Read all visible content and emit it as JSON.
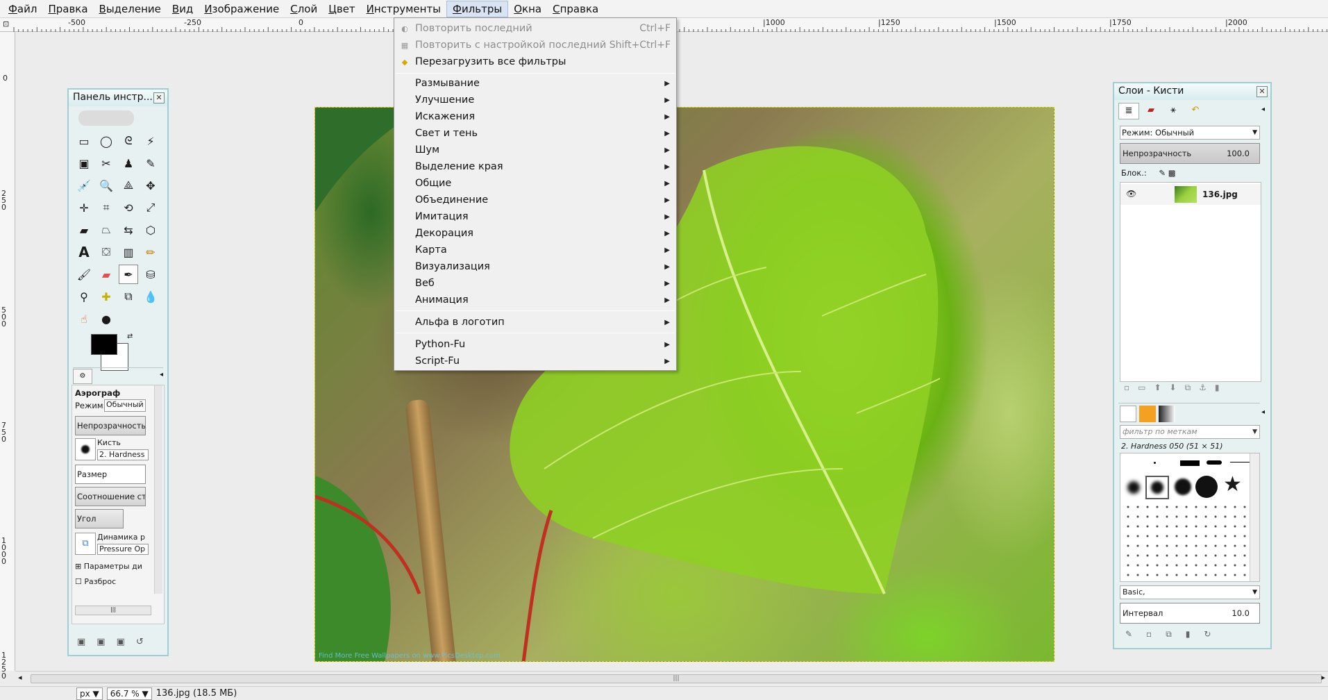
{
  "menubar": {
    "items": [
      "Файл",
      "Правка",
      "Выделение",
      "Вид",
      "Изображение",
      "Слой",
      "Цвет",
      "Инструменты",
      "Фильтры",
      "Окна",
      "Справка"
    ],
    "active": "Фильтры"
  },
  "ruler": {
    "h_labels": [
      "-500",
      "-250",
      "0",
      "|1000",
      "|1250",
      "|1500",
      "|1750",
      "|2000"
    ],
    "v_labels": [
      "0",
      "250",
      "500",
      "750",
      "1000",
      "1250"
    ]
  },
  "filters_menu": {
    "repeat_last": {
      "label": "Повторить последний",
      "shortcut": "Ctrl+F"
    },
    "reshow_last": {
      "label": "Повторить с настройкой последний",
      "shortcut": "Shift+Ctrl+F"
    },
    "reset_all": {
      "label": "Перезагрузить все фильтры"
    },
    "groups": [
      "Размывание",
      "Улучшение",
      "Искажения",
      "Свет и тень",
      "Шум",
      "Выделение края",
      "Общие",
      "Объединение",
      "Имитация",
      "Декорация",
      "Карта",
      "Визуализация",
      "Веб",
      "Анимация"
    ],
    "alpha_logo": "Альфа в логотип",
    "scripts": [
      "Python-Fu",
      "Script-Fu"
    ]
  },
  "toolbox": {
    "title": "Панель инстр...",
    "tool_name": "Аэрограф",
    "mode_label": "Режим:",
    "mode_value": "Обычный",
    "opacity_label": "Непрозрачность",
    "brush_label": "Кисть",
    "brush_value": "2. Hardness",
    "size_label": "Размер",
    "aspect_label": "Соотношение ст.",
    "angle_label": "Угол",
    "dynamics_label": "Динамика р",
    "dynamics_value": "Pressure Op",
    "dynamics_params": "Параметры ди",
    "scatter_label": "Разброс"
  },
  "layers": {
    "title": "Слои - Кисти",
    "mode_label": "Режим: Обычный",
    "opacity_label": "Непрозрачность",
    "opacity_value": "100.0",
    "lock_label": "Блок.:",
    "layer_name": "136.jpg",
    "brush_filter_placeholder": "фильтр по меткам",
    "brush_selected": "2. Hardness 050 (51 × 51)",
    "brush_preset": "Basic,",
    "spacing_label": "Интервал",
    "spacing_value": "10.0"
  },
  "image": {
    "watermark": "Find More Free Wallpapers on www.PicsDesktop.com"
  },
  "statusbar": {
    "unit": "px",
    "zoom": "66.7 %",
    "file_info": "136.jpg (18.5 МБ)"
  },
  "colors": {
    "accent": "#9fcfd5",
    "menu_bg": "#f0f0f0",
    "fg": "#000000",
    "bg": "#ffffff"
  }
}
